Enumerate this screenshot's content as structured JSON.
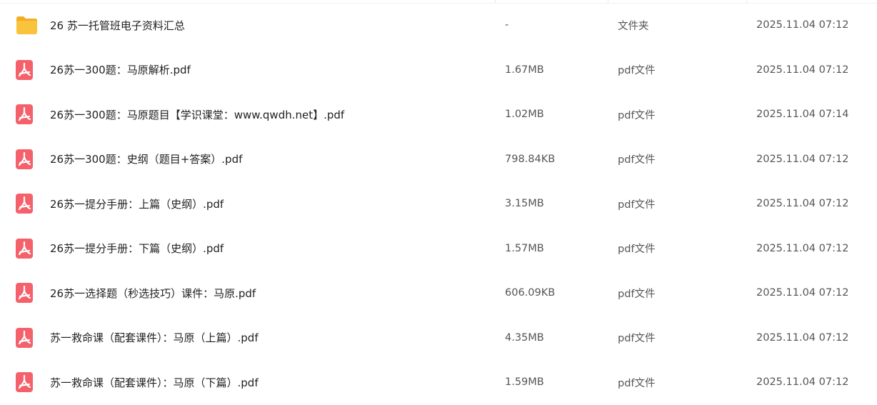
{
  "colors": {
    "folder": "#f9c33c",
    "folder_tab": "#f2ad24",
    "pdf": "#f4616b"
  },
  "files": [
    {
      "icon": "folder-icon",
      "name": "26 苏一托管班电子资料汇总",
      "size": "-",
      "type": "文件夹",
      "date": "2025.11.04 07:12"
    },
    {
      "icon": "pdf-icon",
      "name": "26苏一300题：马原解析.pdf",
      "size": "1.67MB",
      "type": "pdf文件",
      "date": "2025.11.04 07:12"
    },
    {
      "icon": "pdf-icon",
      "name": "26苏一300题：马原题目【学识课堂：www.qwdh.net】.pdf",
      "size": "1.02MB",
      "type": "pdf文件",
      "date": "2025.11.04 07:14"
    },
    {
      "icon": "pdf-icon",
      "name": "26苏一300题：史纲（题目+答案）.pdf",
      "size": "798.84KB",
      "type": "pdf文件",
      "date": "2025.11.04 07:12"
    },
    {
      "icon": "pdf-icon",
      "name": "26苏一提分手册：上篇（史纲）.pdf",
      "size": "3.15MB",
      "type": "pdf文件",
      "date": "2025.11.04 07:12"
    },
    {
      "icon": "pdf-icon",
      "name": "26苏一提分手册：下篇（史纲）.pdf",
      "size": "1.57MB",
      "type": "pdf文件",
      "date": "2025.11.04 07:12"
    },
    {
      "icon": "pdf-icon",
      "name": "26苏一选择题（秒选技巧）课件：马原.pdf",
      "size": "606.09KB",
      "type": "pdf文件",
      "date": "2025.11.04 07:12"
    },
    {
      "icon": "pdf-icon",
      "name": "苏一救命课（配套课件）：马原（上篇）.pdf",
      "size": "4.35MB",
      "type": "pdf文件",
      "date": "2025.11.04 07:12"
    },
    {
      "icon": "pdf-icon",
      "name": "苏一救命课（配套课件）：马原（下篇）.pdf",
      "size": "1.59MB",
      "type": "pdf文件",
      "date": "2025.11.04 07:12"
    }
  ]
}
